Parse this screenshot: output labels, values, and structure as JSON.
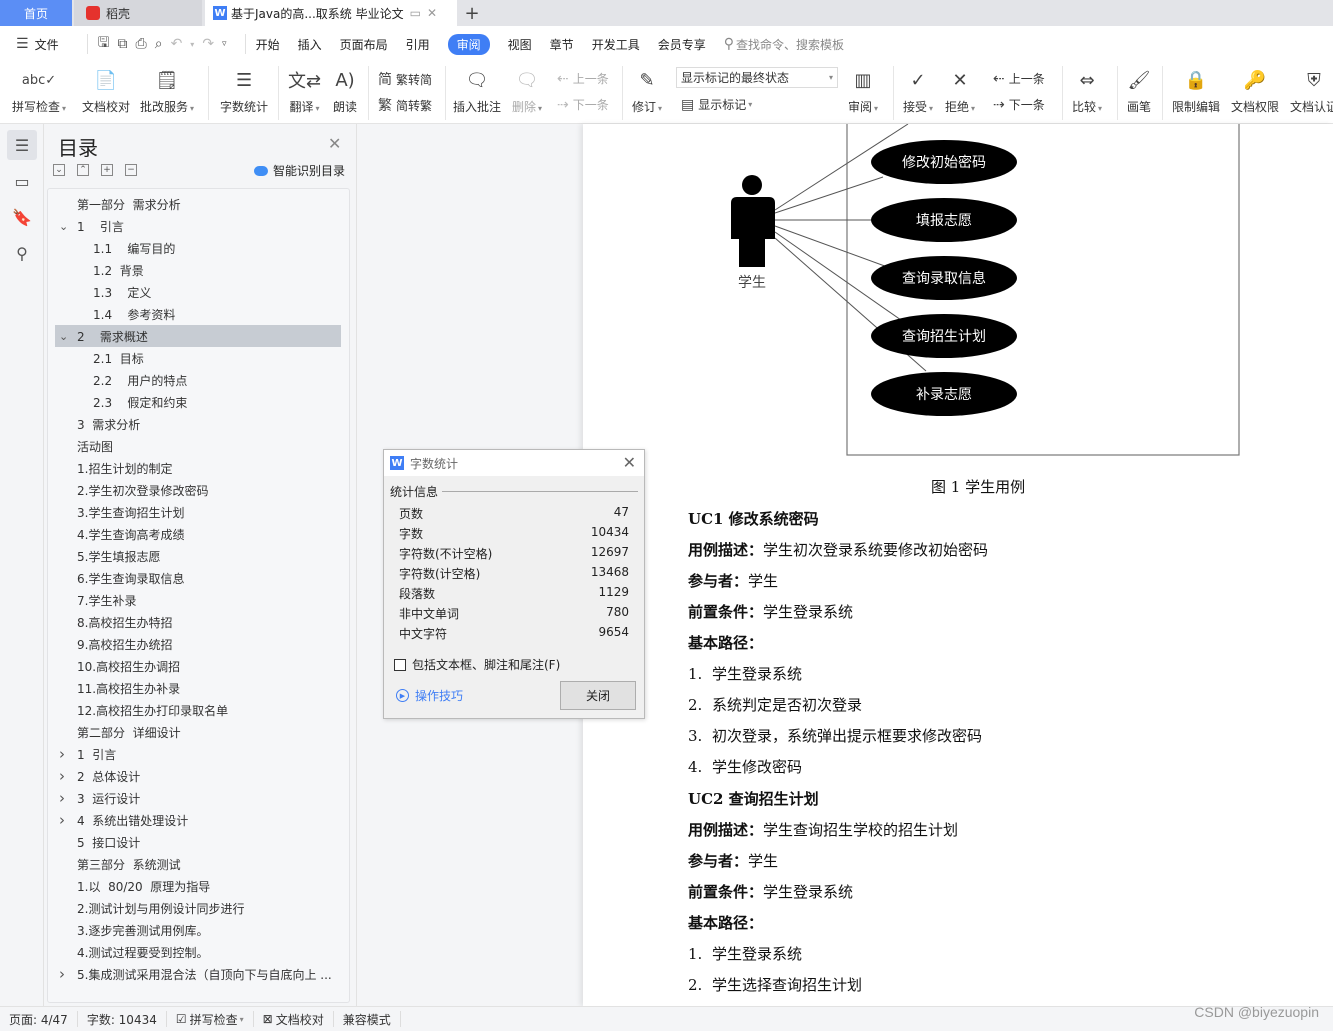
{
  "tabs": {
    "home": "首页",
    "daoke": "稻壳",
    "document": "基于Java的高...取系统 毕业论文",
    "add": "+"
  },
  "menu": {
    "file": "文件",
    "items": [
      "开始",
      "插入",
      "页面布局",
      "引用",
      "审阅",
      "视图",
      "章节",
      "开发工具",
      "会员专享"
    ],
    "active": "审阅",
    "search_placeholder": "查找命令、搜索模板"
  },
  "ribbon": {
    "spell_check": "拼写检查",
    "doc_proofread": "文档校对",
    "review_service": "批改服务",
    "word_count": "字数统计",
    "translate": "翻译",
    "read_aloud": "朗读",
    "trad_to_simp": "繁转简",
    "simp_to_trad": "简转繁",
    "insert_comment": "插入批注",
    "delete": "删除",
    "prev_comment": "上一条",
    "next_comment": "下一条",
    "track_changes": "修订",
    "markup_display": "显示标记的最终状态",
    "show_markup": "显示标记",
    "review_pane": "审阅",
    "accept": "接受",
    "reject": "拒绝",
    "prev_change": "上一条",
    "next_change": "下一条",
    "compare": "比较",
    "ink": "画笔",
    "restrict_editing": "限制编辑",
    "doc_permissions": "文档权限",
    "doc_certify": "文档认证"
  },
  "nav": {
    "title": "目录",
    "smart_toc": "智能识别目录",
    "items": [
      {
        "text": "第一部分  需求分析",
        "indent": 0,
        "arrow": ""
      },
      {
        "text": "1    引言",
        "indent": 0,
        "arrow": "v"
      },
      {
        "text": "1.1    编写目的",
        "indent": 1,
        "arrow": ""
      },
      {
        "text": "1.2  背景",
        "indent": 1,
        "arrow": ""
      },
      {
        "text": "1.3    定义",
        "indent": 1,
        "arrow": ""
      },
      {
        "text": "1.4    参考资料",
        "indent": 1,
        "arrow": ""
      },
      {
        "text": "2    需求概述",
        "indent": 0,
        "arrow": "v",
        "selected": true
      },
      {
        "text": "2.1  目标",
        "indent": 1,
        "arrow": ""
      },
      {
        "text": "2.2    用户的特点",
        "indent": 1,
        "arrow": ""
      },
      {
        "text": "2.3    假定和约束",
        "indent": 1,
        "arrow": ""
      },
      {
        "text": "3  需求分析",
        "indent": 0,
        "arrow": ""
      },
      {
        "text": "活动图",
        "indent": 0,
        "arrow": ""
      },
      {
        "text": "1.招生计划的制定",
        "indent": 0,
        "arrow": ""
      },
      {
        "text": "2.学生初次登录修改密码",
        "indent": 0,
        "arrow": ""
      },
      {
        "text": "3.学生查询招生计划",
        "indent": 0,
        "arrow": ""
      },
      {
        "text": "4.学生查询高考成绩",
        "indent": 0,
        "arrow": ""
      },
      {
        "text": "5.学生填报志愿",
        "indent": 0,
        "arrow": ""
      },
      {
        "text": "6.学生查询录取信息",
        "indent": 0,
        "arrow": ""
      },
      {
        "text": "7.学生补录",
        "indent": 0,
        "arrow": ""
      },
      {
        "text": "8.高校招生办特招",
        "indent": 0,
        "arrow": ""
      },
      {
        "text": "9.高校招生办统招",
        "indent": 0,
        "arrow": ""
      },
      {
        "text": "10.高校招生办调招",
        "indent": 0,
        "arrow": ""
      },
      {
        "text": "11.高校招生办补录",
        "indent": 0,
        "arrow": ""
      },
      {
        "text": "12.高校招生办打印录取名单",
        "indent": 0,
        "arrow": ""
      },
      {
        "text": "第二部分  详细设计",
        "indent": 0,
        "arrow": ""
      },
      {
        "text": "1  引言",
        "indent": 0,
        "arrow": ">"
      },
      {
        "text": "2  总体设计",
        "indent": 0,
        "arrow": ">"
      },
      {
        "text": "3  运行设计",
        "indent": 0,
        "arrow": ">"
      },
      {
        "text": "4  系统出错处理设计",
        "indent": 0,
        "arrow": ">"
      },
      {
        "text": "5  接口设计",
        "indent": 0,
        "arrow": ""
      },
      {
        "text": "第三部分  系统测试",
        "indent": 0,
        "arrow": ""
      },
      {
        "text": "1.以  80/20  原理为指导",
        "indent": 0,
        "arrow": ""
      },
      {
        "text": "2.测试计划与用例设计同步进行",
        "indent": 0,
        "arrow": ""
      },
      {
        "text": "3.逐步完善测试用例库。",
        "indent": 0,
        "arrow": ""
      },
      {
        "text": "4.测试过程要受到控制。",
        "indent": 0,
        "arrow": ""
      },
      {
        "text": "5.集成测试采用混合法（自顶向下与自底向上 ...",
        "indent": 0,
        "arrow": ">"
      }
    ]
  },
  "word_count_dialog": {
    "title": "字数统计",
    "group": "统计信息",
    "rows": [
      {
        "label": "页数",
        "value": "47"
      },
      {
        "label": "字数",
        "value": "10434"
      },
      {
        "label": "字符数(不计空格)",
        "value": "12697"
      },
      {
        "label": "字符数(计空格)",
        "value": "13468"
      },
      {
        "label": "段落数",
        "value": "1129"
      },
      {
        "label": "非中文单词",
        "value": "780"
      },
      {
        "label": "中文字符",
        "value": "9654"
      }
    ],
    "include_label": "包括文本框、脚注和尾注(F)",
    "include_checked": false,
    "tips": "操作技巧",
    "close": "关闭"
  },
  "diagram": {
    "actor": "学生",
    "use_cases": [
      "修改初始密码",
      "填报志愿",
      "查询录取信息",
      "查询招生计划",
      "补录志愿"
    ],
    "caption": "图 1 学生用例"
  },
  "document": {
    "uc1": {
      "heading": "UC1  修改系统密码",
      "desc_label": "用例描述：",
      "desc": "学生初次登录系统要修改初始密码",
      "actor_label": "参与者：",
      "actor": "学生",
      "pre_label": "前置条件：",
      "pre": "学生登录系统",
      "path_label": "基本路径：",
      "steps": [
        "学生登录系统",
        "系统判定是否初次登录",
        "初次登录，系统弹出提示框要求修改密码",
        "学生修改密码"
      ]
    },
    "uc2": {
      "heading": "UC2  查询招生计划",
      "desc_label": "用例描述：",
      "desc": "学生查询招生学校的招生计划",
      "actor_label": "参与者：",
      "actor": "学生",
      "pre_label": "前置条件：",
      "pre": "学生登录系统",
      "path_label": "基本路径：",
      "steps": [
        "学生登录系统",
        "学生选择查询招生计划"
      ]
    }
  },
  "status": {
    "page": "页面: 4/47",
    "words": "字数: 10434",
    "spell": "拼写检查",
    "proof": "文档校对",
    "compat": "兼容模式"
  },
  "watermark": "CSDN @biyezuopin"
}
